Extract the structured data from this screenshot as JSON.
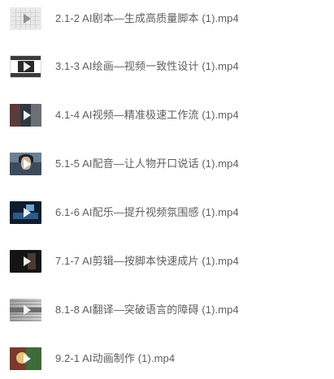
{
  "files": [
    {
      "name": "2.1-2 AI剧本—生成高质量脚本 (1).mp4",
      "icon": "video-thumbnail-icon"
    },
    {
      "name": "3.1-3 AI绘画—视频一致性设计 (1).mp4",
      "icon": "video-thumbnail-icon"
    },
    {
      "name": "4.1-4 AI视频—精准极速工作流 (1).mp4",
      "icon": "video-thumbnail-icon"
    },
    {
      "name": "5.1-5 AI配音—让人物开口说话 (1).mp4",
      "icon": "video-thumbnail-icon"
    },
    {
      "name": "6.1-6 AI配乐—提升视频氛围感 (1).mp4",
      "icon": "video-thumbnail-icon"
    },
    {
      "name": "7.1-7 AI剪辑—按脚本快速成片 (1).mp4",
      "icon": "video-thumbnail-icon"
    },
    {
      "name": "8.1-8 AI翻译—突破语言的障碍 (1).mp4",
      "icon": "video-thumbnail-icon"
    },
    {
      "name": "9.2-1 AI动画制作 (1).mp4",
      "icon": "video-thumbnail-icon"
    }
  ],
  "colors": {
    "text": "#5e5e5e",
    "background": "#ffffff",
    "play_icon": "#ffffff"
  }
}
